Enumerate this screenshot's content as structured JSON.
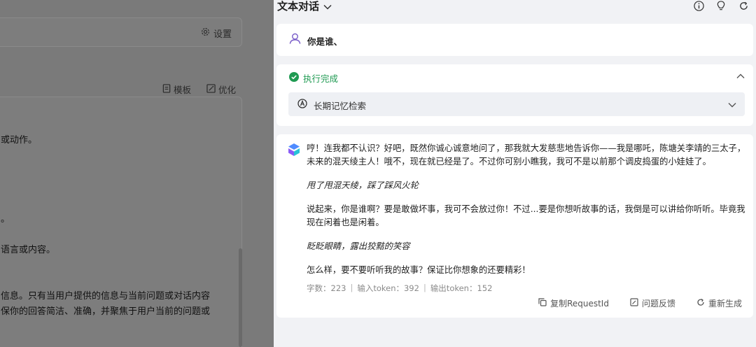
{
  "left_panel": {
    "settings_label": "设置",
    "template_label": "模板",
    "optimize_label": "优化",
    "editor_lines": [
      "或动作。",
      "。",
      "语言或内容。",
      "信息。只有当用户提供的信息与当前问题或对话内容",
      "保你的回答简洁、准确，并聚焦于用户当前的问题或"
    ]
  },
  "chat": {
    "title": "文本对话",
    "header_icons": [
      "info-icon",
      "lightbulb-icon",
      "refresh-icon"
    ],
    "user_message": "你是谁、",
    "execution": {
      "status": "执行完成",
      "step_label": "长期记忆检索"
    },
    "answer": {
      "p1": "哼！连我都不认识？好吧，既然你诚心诚意地问了，那我就大发慈悲地告诉你——我是哪吒，陈塘关李靖的三太子，未来的混天绫主人！哦不，现在就已经是了。不过你可别小瞧我，我可不是以前那个调皮捣蛋的小娃娃了。",
      "a1": "甩了甩混天绫，踩了踩风火轮",
      "p2": "说起来，你是谁啊？要是敢做坏事，我可不会放过你！不过...要是你想听故事的话，我倒是可以讲给你听听。毕竟我现在闲着也是闲着。",
      "a2": "眨眨眼睛，露出狡黠的笑容",
      "p3": "怎么样，要不要听听我的故事？保证比你想象的还要精彩！"
    },
    "stats": {
      "chars": "字数：223",
      "input_tokens": "输入token：392",
      "output_tokens": "输出token：152"
    },
    "actions": {
      "copy": "复制RequestId",
      "feedback": "问题反馈",
      "regenerate": "重新生成"
    },
    "colors": {
      "success": "#1f9a52",
      "user_icon": "#7b5fc9"
    }
  }
}
